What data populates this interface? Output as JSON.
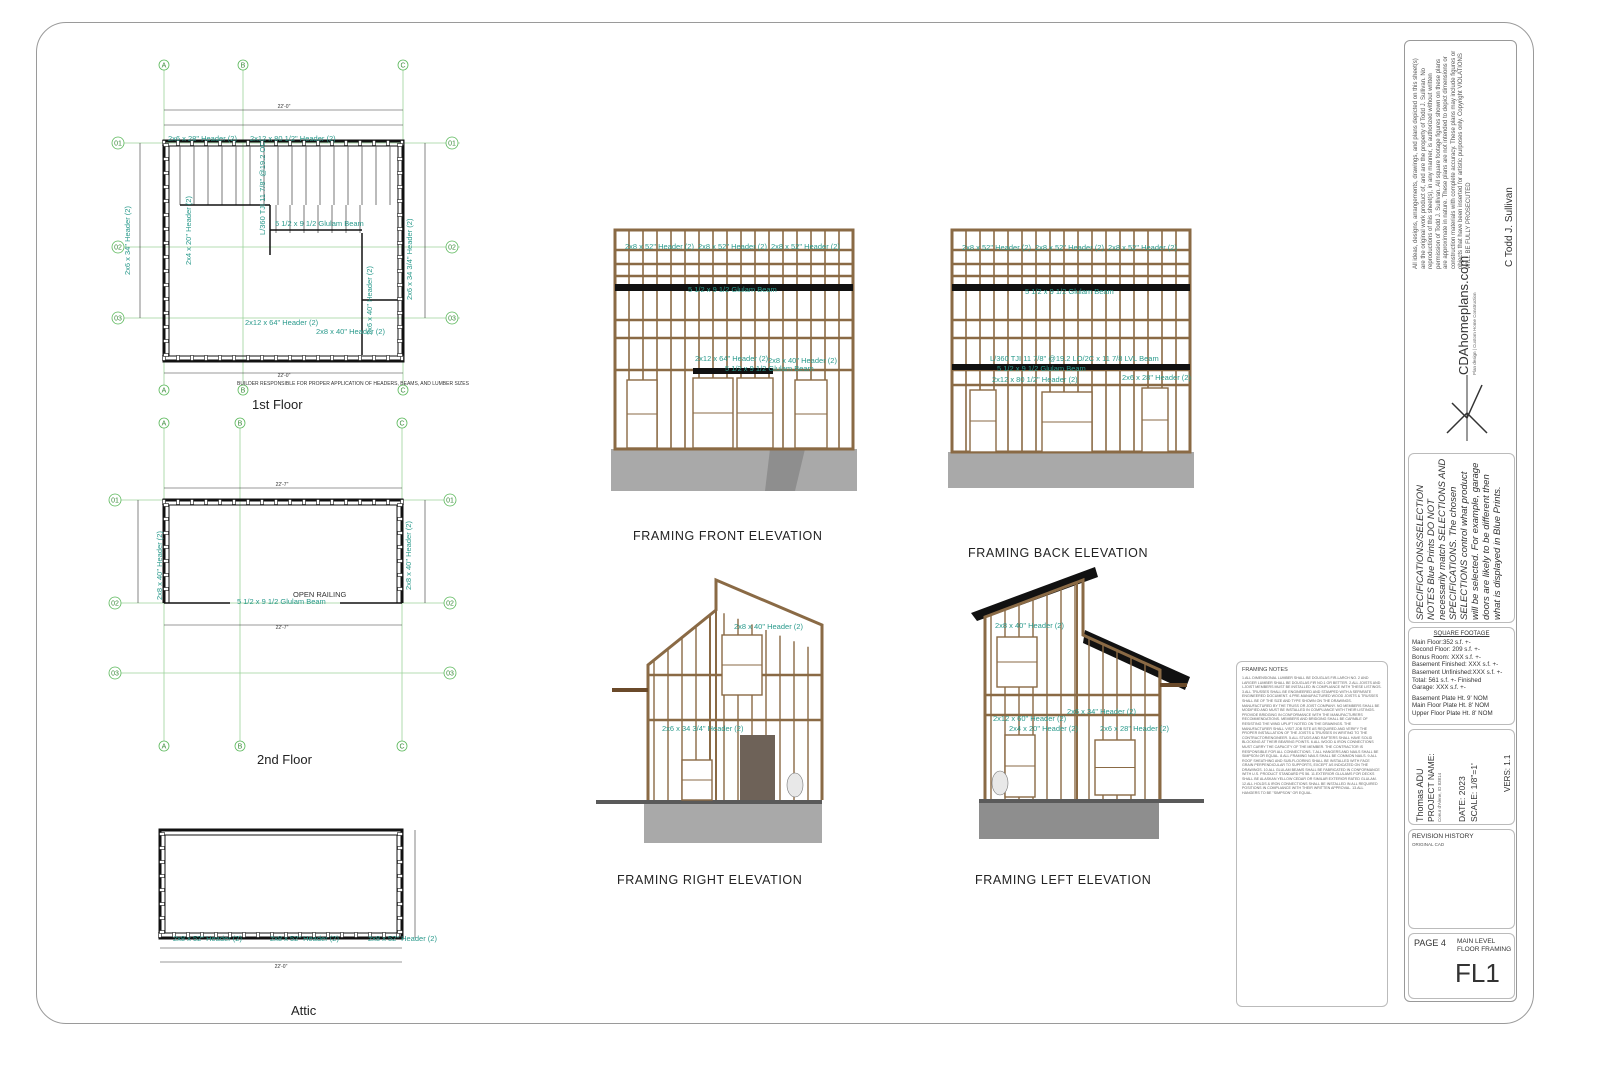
{
  "plans": {
    "first": {
      "title": "1st Floor",
      "note": "BUILDER RESPONSIBLE FOR PROPER APPLICATION OF HEADERS, BEAMS, AND LUMBER SIZES",
      "headers": [
        "2x6 x 28\" Header (2)",
        "2x12 x 80 1/2\" Header (2)",
        "5 1/2 x 9 1/2 Glulam Beam",
        "2x12 x 64\" Header (2)",
        "2x8 x 40\" Header (2)",
        "2x6 x 34\" Header (2)",
        "2x6 x 34 3/4\" Header (2)",
        "2x4 x 20\" Header (2)",
        "2x6 x 40\" Header (2)"
      ],
      "joists": "L/360 TJI 11 7/8\" @19.2 OC",
      "overall": "22'-0\""
    },
    "second": {
      "title": "2nd Floor",
      "railing": "OPEN RAILING",
      "beam": "5 1/2 x 9 1/2 Glulam Beam",
      "header": "2x8 x 40\" Header (2)",
      "overall": "22'-7\""
    },
    "attic": {
      "title": "Attic",
      "header": "2x8 x 52\" Header (2)",
      "overall": "22'-0\""
    },
    "grid": {
      "letters": [
        "A",
        "B",
        "C"
      ],
      "numbers": [
        "01",
        "02",
        "03"
      ]
    }
  },
  "elevations": {
    "front": {
      "title": "FRAMING FRONT ELEVATION",
      "labels": [
        "2x8 x 52\" Header (2)",
        "2x8 x 52\" Header (2)",
        "2x8 x 52\" Header (2)",
        "5 1/2 x 9 1/2 Glulam Beam",
        "2x12 x 64\" Header (2)",
        "2x8 x 40\" Header (2)",
        "5 1/2 x 9 1/2 Glulam Beam"
      ]
    },
    "back": {
      "title": "FRAMING BACK ELEVATION",
      "labels": [
        "2x8 x 52\" Header (2)",
        "2x8 x 52\" Header (2)",
        "2x8 x 52\" Header (2)",
        "5 1/2 x 9 1/2 Glulam Beam",
        "L/360 TJI 11 7/8\" @19.2 LO/2C x 11 7/8 LVL Beam",
        "5 1/2 x 9 1/2 Glulam Beam",
        "2x12 x 80 1/2\" Header (2)",
        "2x6 x 28\" Header (2)"
      ]
    },
    "right": {
      "title": "FRAMING RIGHT ELEVATION",
      "labels": [
        "2x8 x 40\" Header (2)",
        "2x6 x 34 3/4\" Header (2)"
      ]
    },
    "left": {
      "title": "FRAMING LEFT ELEVATION",
      "labels": [
        "2x8 x 40\" Header (2)",
        "2x6 x 34\" Header (2)",
        "2x12 x 60\" Header (2)",
        "2x4 x 20\" Header (2)",
        "2x6 x 28\" Header (2)"
      ]
    }
  },
  "framing_notes": {
    "title": "FRAMING NOTES",
    "body": "1.ALL DIMENSIONAL LUMBER SHALL BE DOUGLAS FIR-LARCH NO. 2 AND LARGER LUMBER SHALL BE DOUGLAS FIR NO.1 OR BETTER. 2.ALL JOISTS AND I-JOIST MEMBERS MUST BE INSTALLED IN COMPLIANCE WITH THESE LISTINGS. 3.ALL TRUSSES SHALL BE ENGINEERED AND STAMPED WITH A SEPARATE ENGINEERED DOCUMENT. 4.PRE-MANUFACTURED WOOD JOISTS & TRUSSES SHALL BE OF THE SIZE AND TYPE SHOWN ON THE DRAWINGS. MANUFACTURED BY THE TRUSS OR JOIST COMPANY. NO MEMBERS SHALL BE MODIFIED AND MUST BE INSTALLED IN COMPLIANCE WITH THEIR LISTINGS. PROVIDE BRIDGING IN CONFORMANCE WITH THE MANUFACTURERS RECOMMENDATIONS. MEMBERS AND BRIDGING SHALL BE CAPABLE OF RESISTING THE WIND UPLIFT NOTED ON THE DRAWINGS. THE MANUFACTURER SHALL VISIT JOB SITE AS REQUIRED AND VERIFY THE PROPER INSTALLATION OF THE JOISTS & TRUSSES IN WRITING TO THE CONTRACTOR/ENGINEER. 5.ALL STUDS AND RAFTERS SHALL HAVE SOLID BLOCKING AT THEIR BEARING POINTS. 6.ALL WOOD & IRON CONNECTIONS MUST CARRY THE CAPACITY OF THE MEMBER. THE CONTRACTOR IS RESPONSIBLE FOR ALL CONNECTIONS. 7.ALL HANGERS AND NAILS SHALL BE SIMPSON OR EQUAL. 8.ALL FRAMING NAILS SHALL BE COMMON NAILS. 9.ALL ROOF SHEATHING AND SUB-FLOORING SHALL BE INSTALLED WITH FACE GRAIN PERPENDICULAR TO SUPPORTS, EXCEPT AS INDICATED ON THE DRAWINGS. 10.ALL GLULAM BEAMS SHALL BE FABRICATED IN CONFORMANCE WITH U.S. PRODUCT STANDARD PS 56. 11.EXTERIOR GLULAMS FOR DECKS SHALL BE ALASKAN YELLOW CEDAR OR SIMILAR EXTERIOR RATED GLULAM. 12.ALL HOLDS & IRON CONNECTIONS SHALL BE INSTALLED IN ALL REQUIRED POSITIONS IN COMPLIANCE WITH THEIR WRITTEN APPROVAL. 13.ALL HANGERS TO BE \"SIMPSON\" OR EQUAL."
  },
  "title_block": {
    "copyright": "All ideas, designs, arrangements, drawings, and plans depicted on this sheet(s) are the original work product of, and are the property of Todd J. Sullivan. No reproductions of this sheet(s), in any manner, is authorized without written permission of Todd J. Sullivan. All square footage figures shown on these plans are approximate in nature. These plans are not intended to depict dimensions or construction materials with complete accuracy. These plans may include figures or objects that have been inserted for artistic purposes only. Copyright VIOLATIONS WILL BE FULLY PROSECUTED",
    "author": "C Todd J. Sullivan",
    "website": "CDAhomeplans.com",
    "website_tagline": "Plan design | Custom Home Construction",
    "spec_note": "SPECIFICATIONS/SELECTION NOTES Blue Prints DO NOT necessarily match SELECTIONS AND SPECIFICATIONS. The chosen SELECTIONS control what product will be selected. For example, garage doors are likely to be different then what is displayed in Blue Prints.",
    "sqft_title": "SQUARE FOOTAGE",
    "sqft": [
      "Main Floor:352 s.f. +-",
      "Second Floor: 209 s.f. +-",
      "Bonus Room: XXX s.f. +-",
      "Basement Finished: XXX s.f. +-",
      "Basement Unfinished:XXX s.f. +-",
      "Total: 561 s.f. +- Finished",
      "Garage: XXX s.f. +-"
    ],
    "plate": [
      "Basement Plate Ht. 9' NOM",
      "Main Floor Plate Ht. 8' NOM",
      "Upper Floor Plate Ht. 8' NOM"
    ],
    "project_label": "PROJECT NAME:",
    "project_name": "Thomas ADU",
    "project_addr": "Coeur d'Alene, ID 83814",
    "date": "DATE: 2023",
    "scale": "SCALE: 1/8\"=1'",
    "version": "VERS: 1.1",
    "revision_title": "REVISION HISTORY",
    "revision": "ORIGINAL CAD",
    "page": "PAGE 4",
    "page_desc": "MAIN LEVEL FLOOR FRAMING",
    "sheet_id": "FL1"
  },
  "colors": {
    "annotation": "#2a9a8c",
    "grid": "#5ab85a",
    "stud": "#8a6a45",
    "concrete": "#9a9a9a"
  }
}
